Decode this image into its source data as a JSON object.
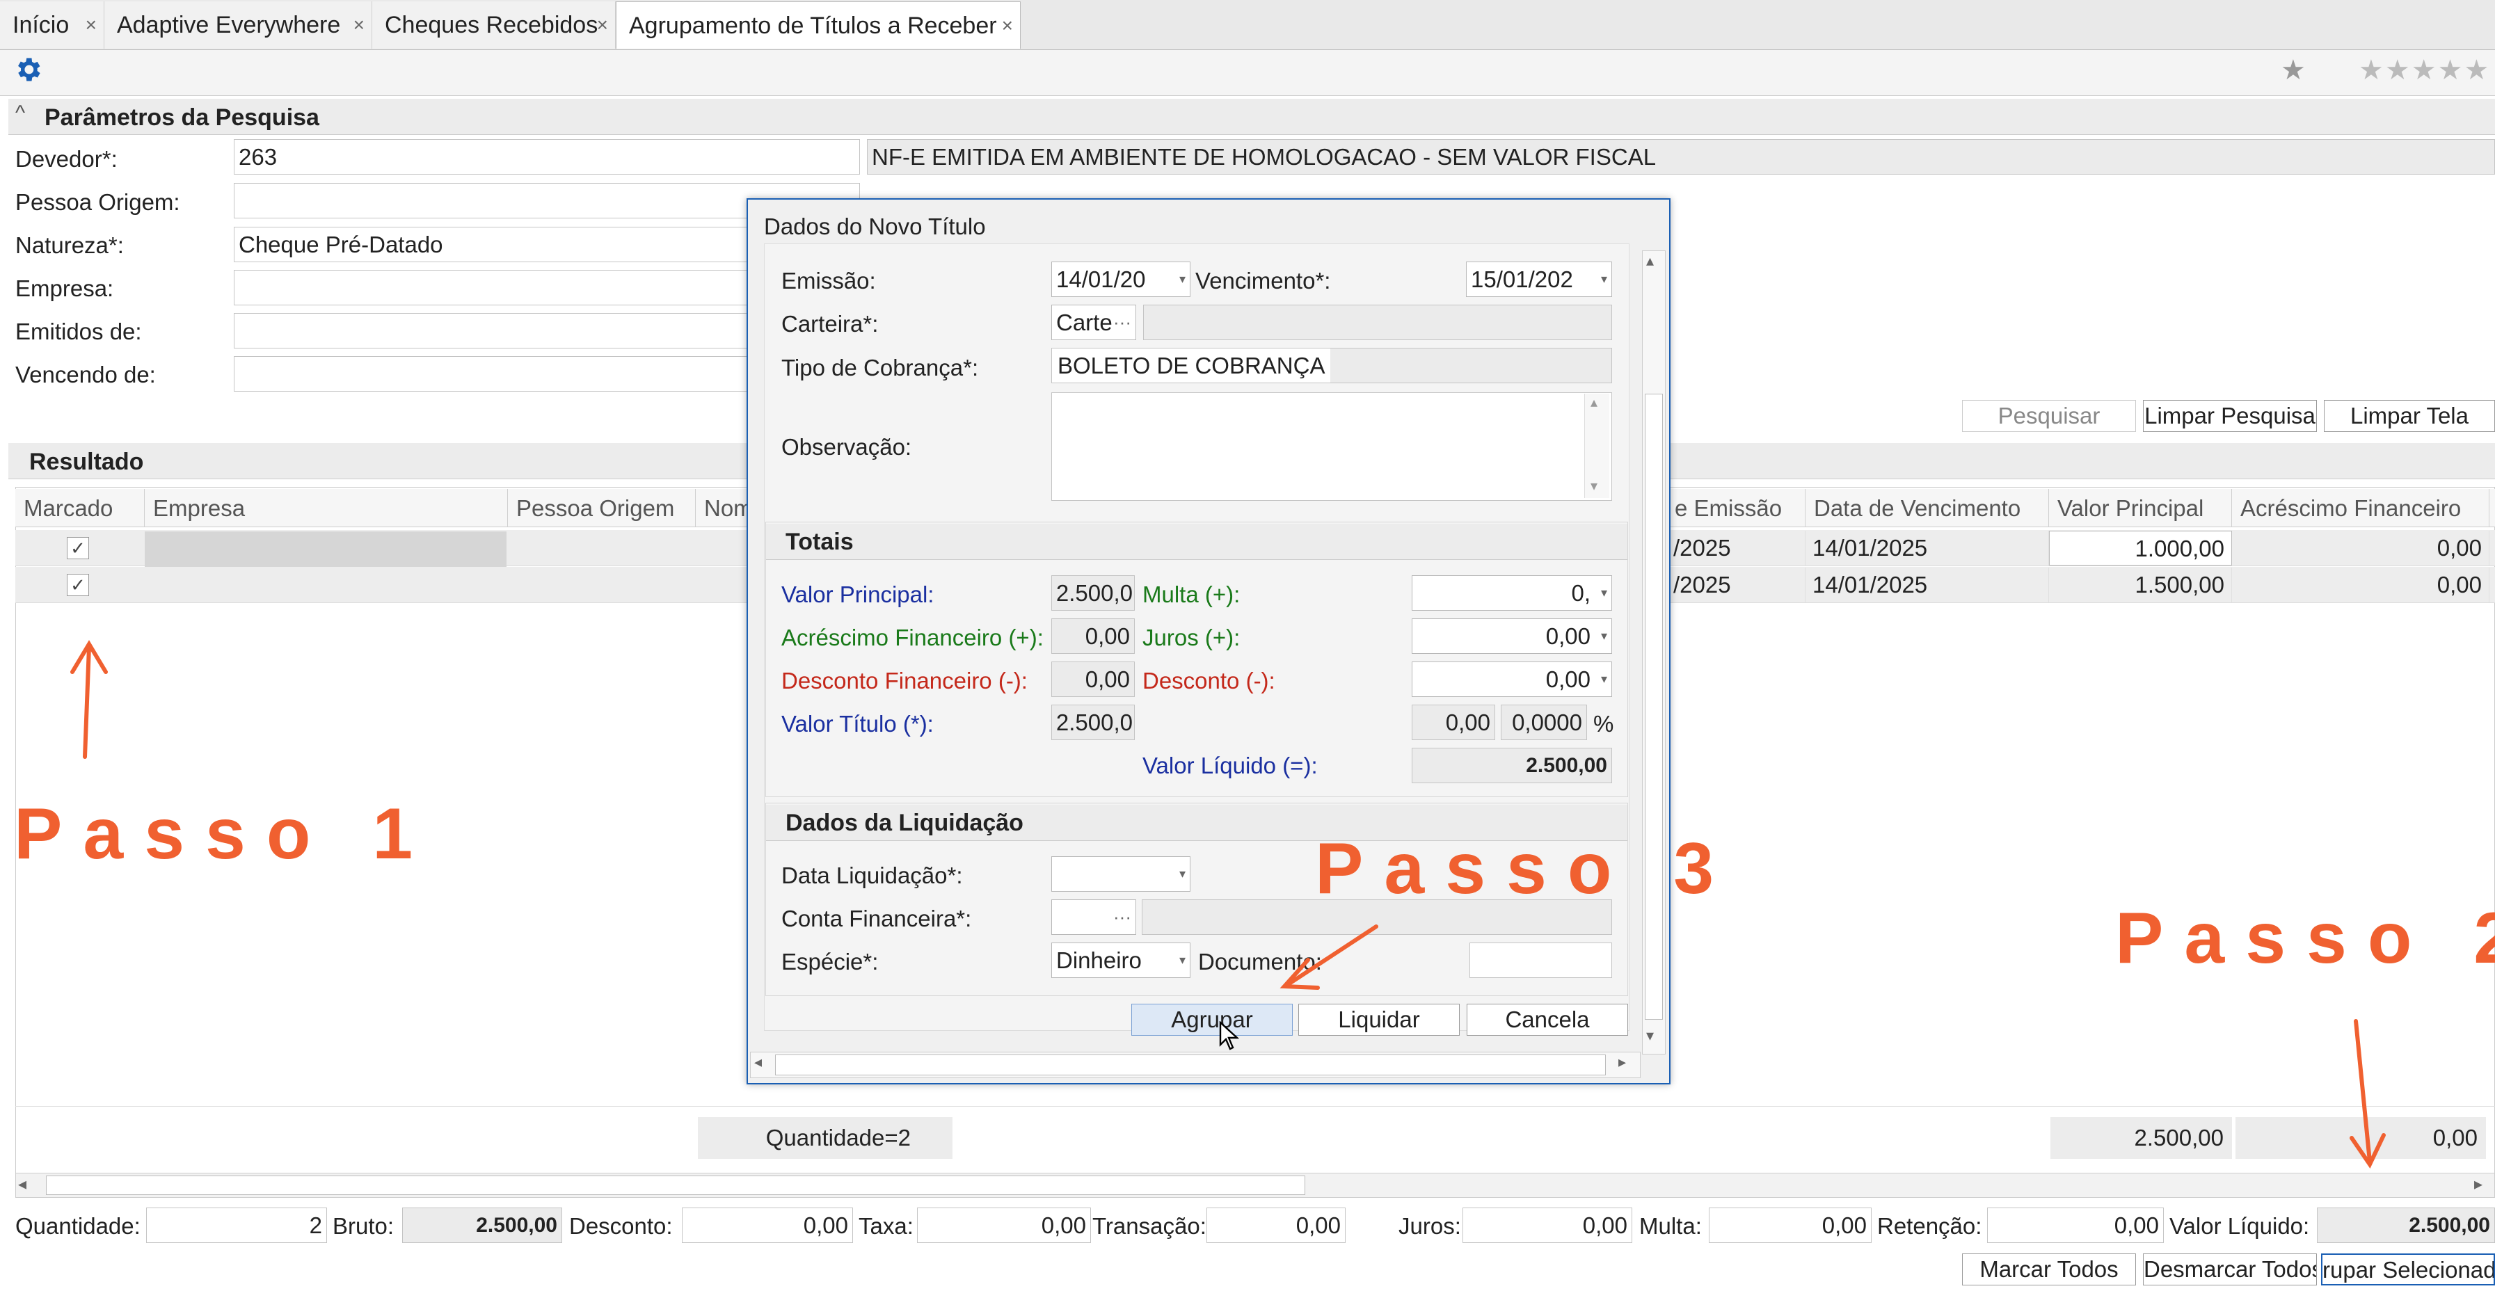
{
  "tabs": [
    {
      "label": "Início"
    },
    {
      "label": "Adaptive Everywhere"
    },
    {
      "label": "Cheques Recebidos"
    },
    {
      "label": "Agrupamento de Títulos a Receber"
    }
  ],
  "tab_close": "×",
  "search_params": {
    "title": "Parâmetros da Pesquisa",
    "devedor_label": "Devedor*:",
    "devedor_code": "263",
    "devedor_name": "NF-E EMITIDA EM AMBIENTE DE HOMOLOGACAO - SEM VALOR FISCAL",
    "pessoa_origem_label": "Pessoa Origem:",
    "natureza_label": "Natureza*:",
    "natureza_value": "Cheque Pré-Datado",
    "empresa_label": "Empresa:",
    "emitidos_label": "Emitidos de:",
    "vencendo_label": "Vencendo de:",
    "pesquisar_button": "Pesquisar",
    "limpar_pesquisa_button": "Limpar Pesquisa",
    "limpar_tela_button": "Limpar Tela"
  },
  "result": {
    "title": "Resultado",
    "columns_left": [
      "Marcado",
      "Empresa",
      "Pessoa Origem",
      "Nom"
    ],
    "columns_right": [
      "e Emissão",
      "Data de Vencimento",
      "Valor Principal",
      "Acréscimo Financeiro"
    ],
    "rows": [
      {
        "emissao": "/2025",
        "vencimento": "14/01/2025",
        "valor_principal": "1.000,00",
        "acrescimo": "0,00"
      },
      {
        "emissao": "/2025",
        "vencimento": "14/01/2025",
        "valor_principal": "1.500,00",
        "acrescimo": "0,00"
      }
    ],
    "check_mark": "✓",
    "quantidade_summary": "Quantidade=2",
    "total_principal": "2.500,00",
    "total_acrescimo": "0,00"
  },
  "footer": {
    "quantidade_label": "Quantidade:",
    "quantidade_value": "2",
    "bruto_label": "Bruto:",
    "bruto_value": "2.500,00",
    "desconto_label": "Desconto:",
    "desconto_value": "0,00",
    "taxa_label": "Taxa:",
    "taxa_value": "0,00",
    "transacao_label": "Transação:",
    "transacao_value": "0,00",
    "juros_label": "Juros:",
    "juros_value": "0,00",
    "multa_label": "Multa:",
    "multa_value": "0,00",
    "retencao_label": "Retenção:",
    "retencao_value": "0,00",
    "liquido_label": "Valor Líquido:",
    "liquido_value": "2.500,00",
    "marcar_todos": "Marcar Todos",
    "desmarcar_todos": "Desmarcar Todos",
    "agrupar_selecionados": "rupar Selecionad"
  },
  "dialog": {
    "title": "Dados do Novo Título",
    "emissao_label": "Emissão:",
    "emissao_value": "14/01/20",
    "vencimento_label": "Vencimento*:",
    "vencimento_value": "15/01/202",
    "carteira_label": "Carteira*:",
    "carteira_value": "Carte",
    "tipo_cobranca_label": "Tipo de Cobrança*:",
    "tipo_cobranca_value": "BOLETO DE COBRANÇA",
    "observacao_label": "Observação:",
    "totais_title": "Totais",
    "valor_principal_label": "Valor Principal:",
    "valor_principal_value": "2.500,0",
    "multa_label": "Multa (+):",
    "multa_value": "0,",
    "acrescimo_label": "Acréscimo Financeiro (+):",
    "acrescimo_value": "0,00",
    "juros_label": "Juros (+):",
    "juros_value": "0,00",
    "desconto_fin_label": "Desconto Financeiro (-):",
    "desconto_fin_value": "0,00",
    "desconto_label": "Desconto (-):",
    "desconto_value": "0,00",
    "valor_titulo_label": "Valor Título (*):",
    "valor_titulo_value": "2.500,0",
    "pct_value_a": "0,00",
    "pct_value_b": "0,0000",
    "pct_symbol": "%",
    "valor_liquido_label": "Valor Líquido (=):",
    "valor_liquido_value": "2.500,00",
    "liquidacao_title": "Dados da Liquidação",
    "data_liq_label": "Data Liquidação*:",
    "conta_fin_label": "Conta Financeira*:",
    "especie_label": "Espécie*:",
    "especie_value": "Dinheiro",
    "documento_label": "Documento:",
    "agrupar_button": "Agrupar",
    "liquidar_button": "Liquidar",
    "cancelar_button": "Cancela"
  },
  "annotations": {
    "passo1": "Passo 1",
    "passo2": "Passo 2",
    "passo3": "Passo 3"
  },
  "colors": {
    "accent": "#1a5fb4",
    "annotation": "#f06030",
    "blue_label": "#1a2fa0",
    "green_label": "#1a7a1a",
    "red_label": "#c4281a"
  }
}
